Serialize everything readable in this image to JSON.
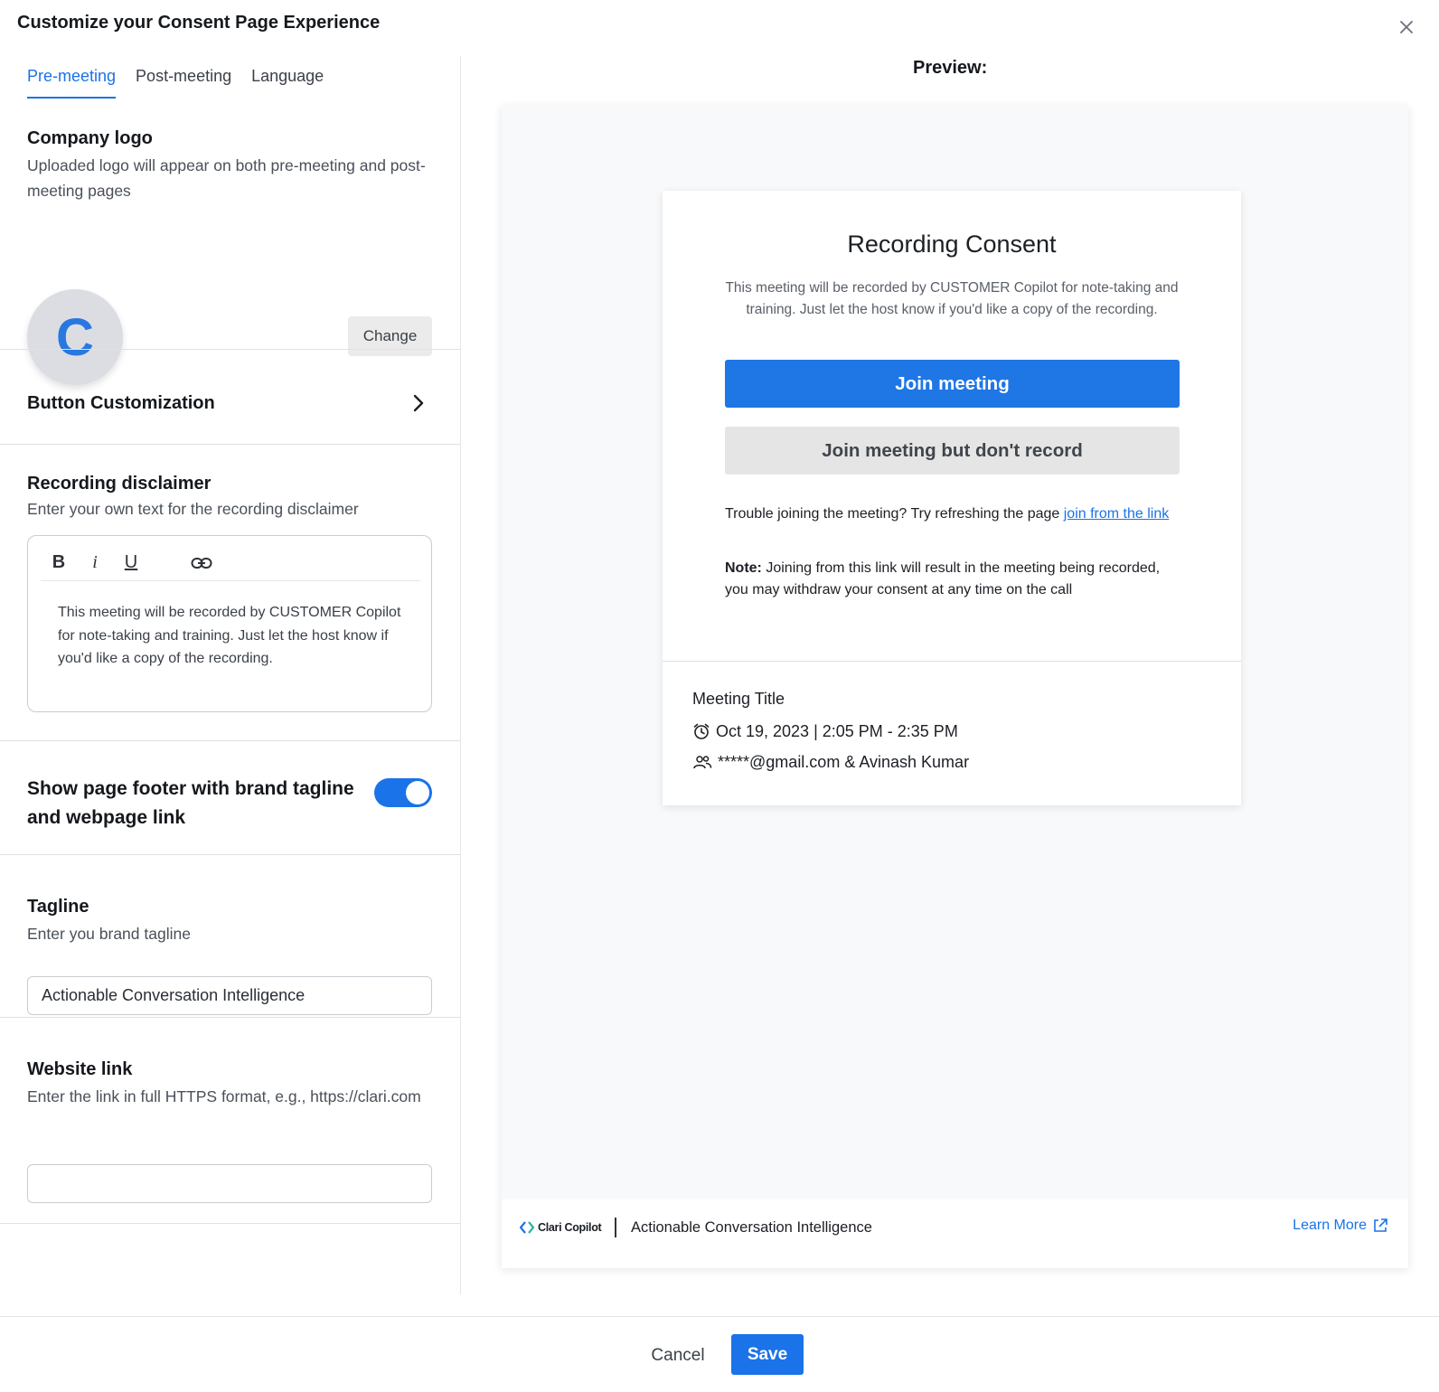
{
  "modal": {
    "title": "Customize your Consent Page Experience"
  },
  "tabs": [
    {
      "label": "Pre-meeting",
      "active": true
    },
    {
      "label": "Post-meeting",
      "active": false
    },
    {
      "label": "Language",
      "active": false
    }
  ],
  "company_logo": {
    "title": "Company logo",
    "subtitle": "Uploaded logo will appear on both pre-meeting and post-meeting pages",
    "avatar_letter": "C",
    "change_label": "Change"
  },
  "button_customization": {
    "title": "Button Customization",
    "icon": "chevron-right-icon"
  },
  "recording_disclaimer": {
    "title": "Recording disclaimer",
    "subtitle": "Enter your own text for the recording disclaimer",
    "toolbar": [
      {
        "label": "B",
        "icon": "bold-icon"
      },
      {
        "label": "i",
        "icon": "italic-icon"
      },
      {
        "label": "U",
        "icon": "underline-icon"
      },
      {
        "label": "",
        "icon": "link-icon"
      }
    ],
    "text": "This meeting will be recorded by CUSTOMER Copilot for note-taking and training. Just let the host know if you'd like a copy of the recording."
  },
  "footer_toggle": {
    "label": "Show page footer with brand tagline and webpage link",
    "enabled": true
  },
  "tagline": {
    "title": "Tagline",
    "subtitle": "Enter you brand tagline",
    "value": "Actionable Conversation Intelligence"
  },
  "website_link": {
    "title": "Website link",
    "subtitle": "Enter the link in full HTTPS format, e.g., https://clari.com",
    "value": ""
  },
  "preview": {
    "label": "Preview:",
    "card": {
      "title": "Recording Consent",
      "description": "This meeting will be recorded by CUSTOMER Copilot for note-taking and training. Just let the host know if you'd like a copy of the recording.",
      "join_label": "Join meeting",
      "join_no_record_label": "Join meeting but don't record",
      "trouble_text": "Trouble joining the meeting? Try refreshing the page ",
      "trouble_link": "join from the link",
      "note_label": "Note:",
      "note_text": " Joining from this link will result in the meeting being recorded, you may withdraw your consent at any time on the call",
      "meeting_title": "Meeting Title",
      "meeting_time": "Oct 19, 2023 | 2:05 PM - 2:35 PM",
      "meeting_attendees": "*****@gmail.com & Avinash Kumar"
    },
    "footer": {
      "brand_name": "Clari Copilot",
      "tagline": "Actionable Conversation Intelligence",
      "learn_more": "Learn More"
    }
  },
  "actions": {
    "cancel_label": "Cancel",
    "save_label": "Save"
  },
  "colors": {
    "accent": "#1a73e8",
    "avatar_bg": "#dcdde2",
    "secondary_button": "#e5e5e5"
  }
}
